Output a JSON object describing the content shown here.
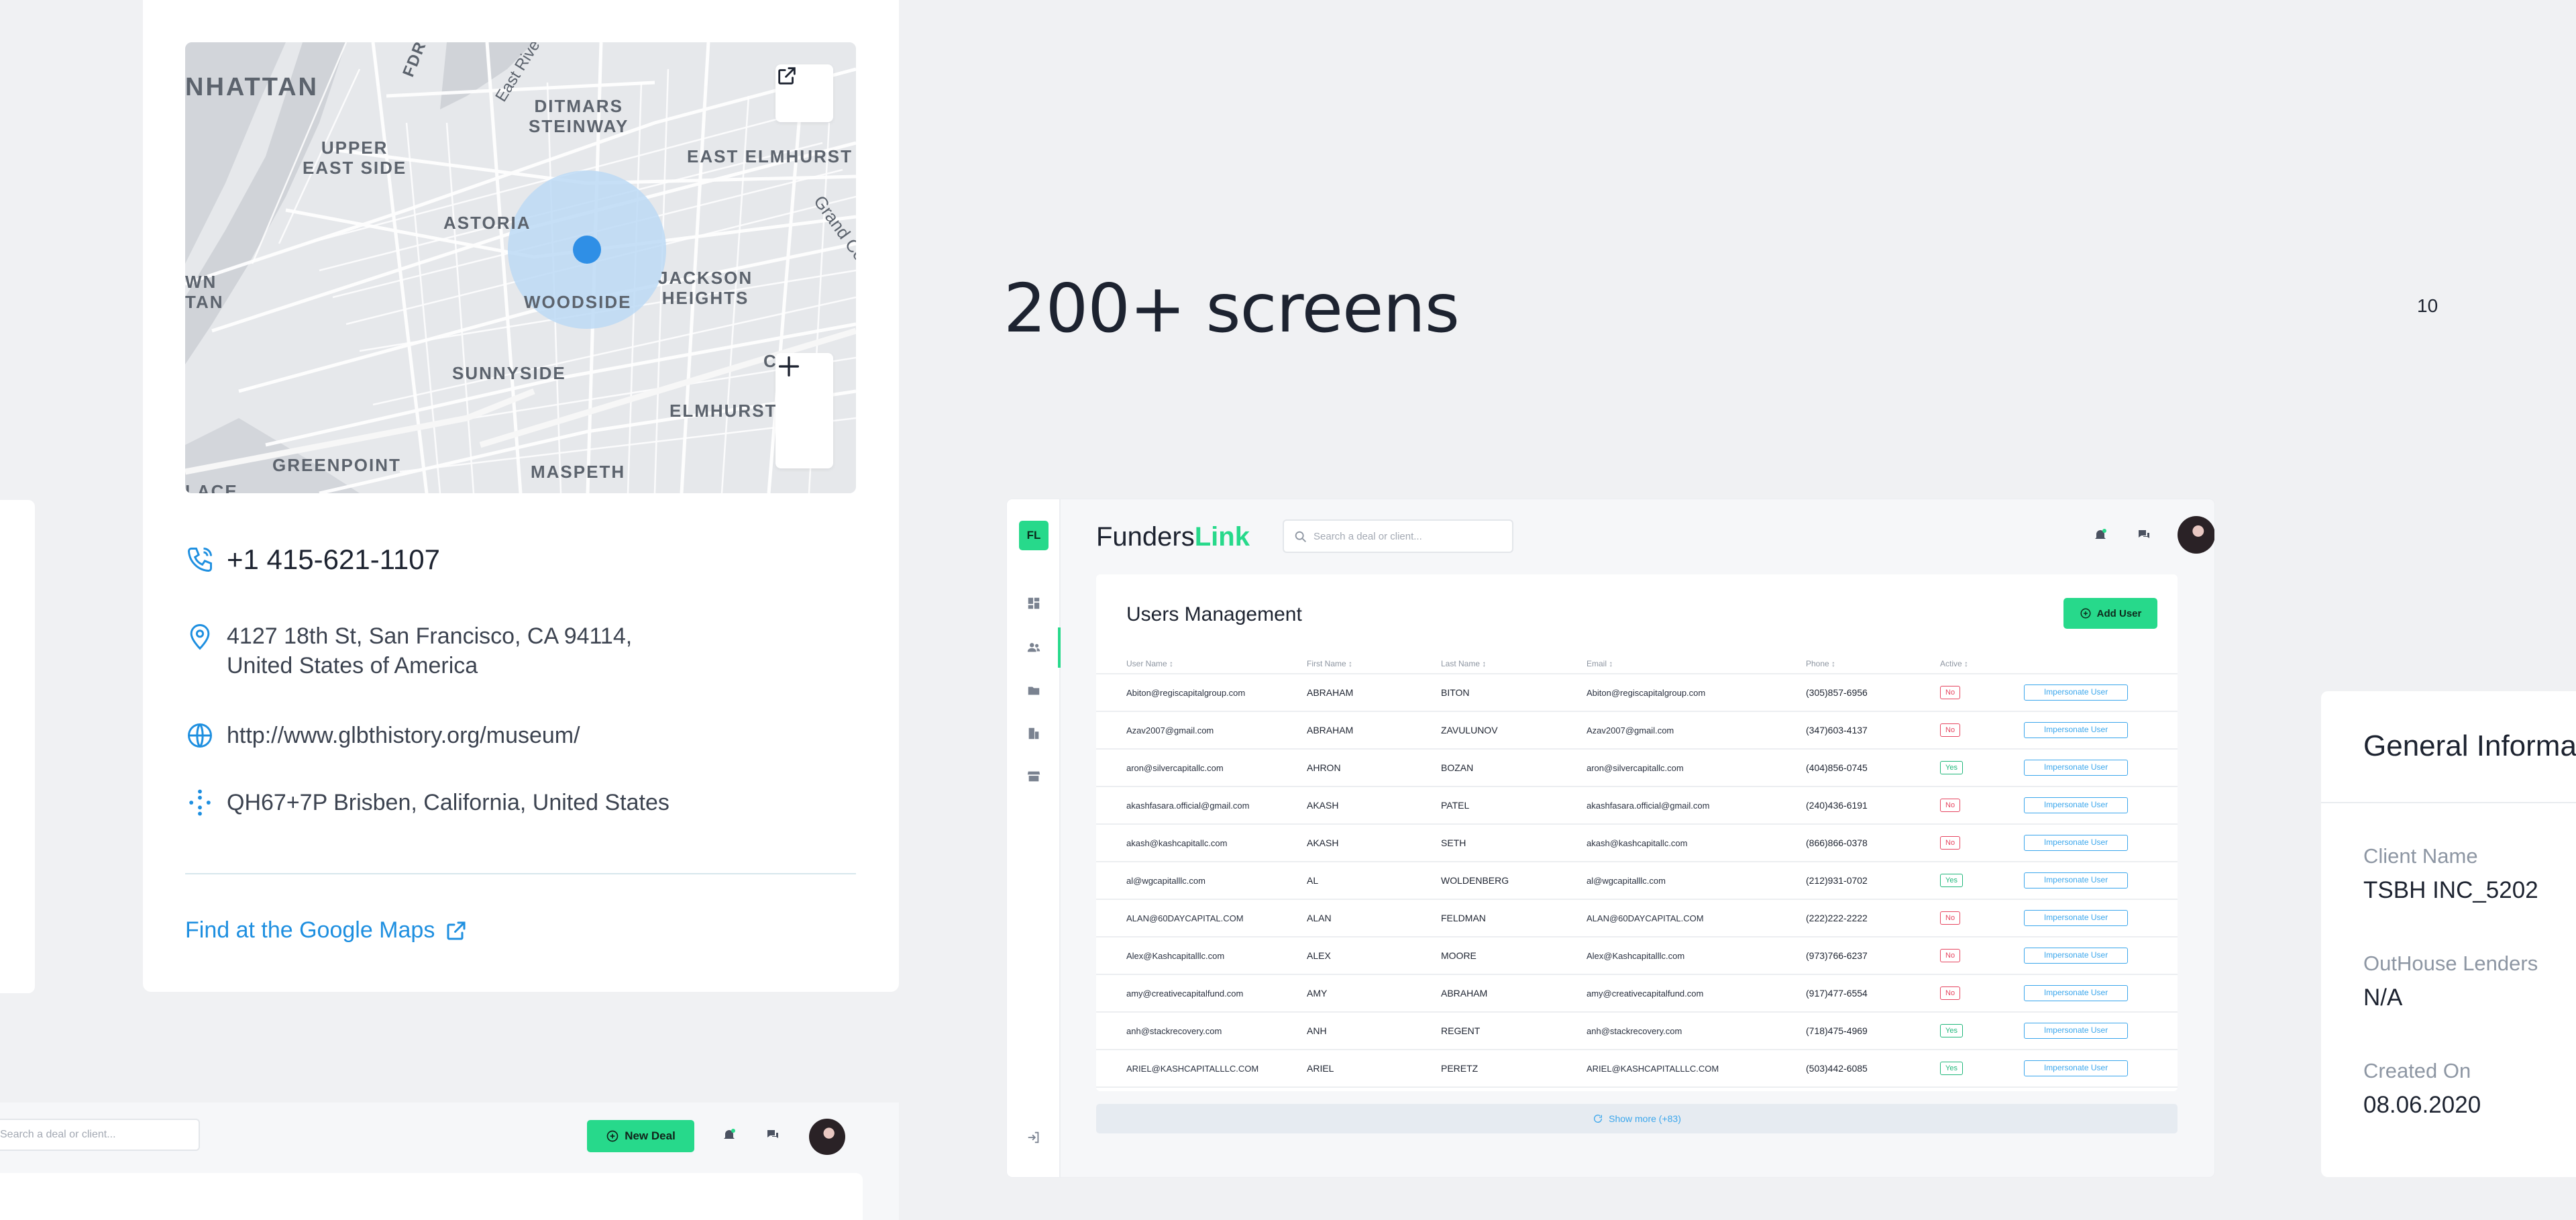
{
  "contact": {
    "map_labels": {
      "manhattan": "NHATTAN",
      "fdr": "FDR",
      "east_river": "East Rive",
      "ditmars": "DITMARS\nSTEINWAY",
      "upper_east": "UPPER\nEAST SIDE",
      "east_elmhurst": "EAST ELMHURST",
      "astoria": "ASTORIA",
      "grand_central": "Grand Ce",
      "wn_tan": "WN\nTAN",
      "woodside": "WOODSIDE",
      "jackson_heights": "JACKSON\nHEIGHTS",
      "corona": "C     A",
      "sunnyside": "SUNNYSIDE",
      "elmhurst": "ELMHURST",
      "greenpoint": "GREENPOINT",
      "maspeth": "MASPETH",
      "lace": "LACE"
    },
    "phone": "+1 415-621-1107",
    "address_line1": "4127 18th St, San Francisco, CA 94114,",
    "address_line2": "United States of America",
    "website": "http://www.glbthistory.org/museum/",
    "plus_code": "QH67+7P Brisben, California, United States",
    "google_maps_link": "Find at the Google Maps"
  },
  "strip": {
    "search_placeholder": "Search a deal or client...",
    "new_deal_label": "New Deal"
  },
  "heading": {
    "title": "200+ screens",
    "page_number": "10"
  },
  "app": {
    "logo": "FL",
    "brand_part1": "Funders",
    "brand_part2": "Link",
    "search_placeholder": "Search a deal or client...",
    "panel_title": "Users Management",
    "add_user_label": "Add User",
    "columns": [
      "User Name ↕",
      "First Name ↕",
      "Last Name ↕",
      "Email ↕",
      "Phone ↕",
      "Active ↕",
      ""
    ],
    "impersonate_label": "Impersonate User",
    "rows": [
      {
        "username": "Abiton@regiscapitalgroup.com",
        "first": "ABRAHAM",
        "last": "BITON",
        "email": "Abiton@regiscapitalgroup.com",
        "phone": "(305)857-6956",
        "active": "No"
      },
      {
        "username": "Azav2007@gmail.com",
        "first": "ABRAHAM",
        "last": "ZAVULUNOV",
        "email": "Azav2007@gmail.com",
        "phone": "(347)603-4137",
        "active": "No"
      },
      {
        "username": "aron@silvercapitallc.com",
        "first": "AHRON",
        "last": "BOZAN",
        "email": "aron@silvercapitallc.com",
        "phone": "(404)856-0745",
        "active": "Yes"
      },
      {
        "username": "akashfasara.official@gmail.com",
        "first": "AKASH",
        "last": "PATEL",
        "email": "akashfasara.official@gmail.com",
        "phone": "(240)436-6191",
        "active": "No"
      },
      {
        "username": "akash@kashcapitallc.com",
        "first": "AKASH",
        "last": "SETH",
        "email": "akash@kashcapitallc.com",
        "phone": "(866)866-0378",
        "active": "No"
      },
      {
        "username": "al@wgcapitalllc.com",
        "first": "AL",
        "last": "WOLDENBERG",
        "email": "al@wgcapitalllc.com",
        "phone": "(212)931-0702",
        "active": "Yes"
      },
      {
        "username": "ALAN@60DAYCAPITAL.COM",
        "first": "ALAN",
        "last": "FELDMAN",
        "email": "ALAN@60DAYCAPITAL.COM",
        "phone": "(222)222-2222",
        "active": "No"
      },
      {
        "username": "Alex@Kashcapitalllc.com",
        "first": "ALEX",
        "last": "MOORE",
        "email": "Alex@Kashcapitalllc.com",
        "phone": "(973)766-6237",
        "active": "No"
      },
      {
        "username": "amy@creativecapitalfund.com",
        "first": "AMY",
        "last": "ABRAHAM",
        "email": "amy@creativecapitalfund.com",
        "phone": "(917)477-6554",
        "active": "No"
      },
      {
        "username": "anh@stackrecovery.com",
        "first": "ANH",
        "last": "REGENT",
        "email": "anh@stackrecovery.com",
        "phone": "(718)475-4969",
        "active": "Yes"
      },
      {
        "username": "ARIEL@KASHCAPITALLLC.COM",
        "first": "ARIEL",
        "last": "PERETZ",
        "email": "ARIEL@KASHCAPITALLLC.COM",
        "phone": "(503)442-6085",
        "active": "Yes"
      }
    ],
    "show_more": "Show more (+83)"
  },
  "general_info": {
    "title": "General Informa",
    "client_name_label": "Client Name",
    "client_name_value": "TSBH INC_5202",
    "outhouse_label": "OutHouse Lenders",
    "outhouse_value": "N/A",
    "created_label": "Created On",
    "created_value": "08.06.2020"
  },
  "colors": {
    "accent_green": "#27d98b",
    "link_blue": "#1e8fe0",
    "danger_red": "#e64560",
    "map_dot": "#2f8fe6"
  }
}
